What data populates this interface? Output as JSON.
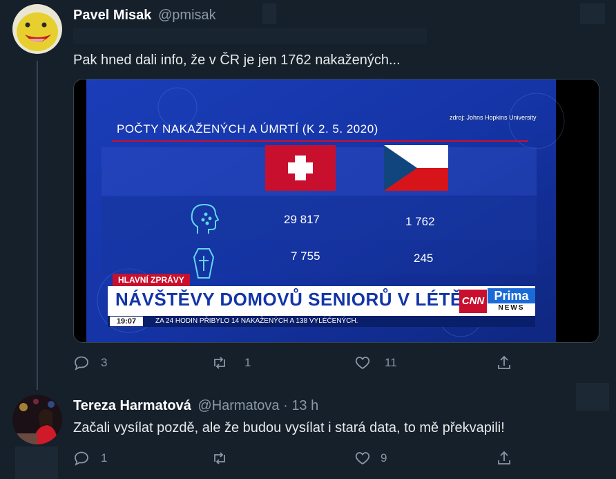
{
  "tweet1": {
    "name": "Pavel Misak",
    "handle": "@pmisak",
    "text": "Pak hned dali info, že v ČR je jen 1762 nakažených...",
    "actions": {
      "reply_count": "3",
      "retweet_count": "1",
      "like_count": "11"
    },
    "media": {
      "source": "zdroj: Johns Hopkins University",
      "title": "POČTY NAKAŽENÝCH A ÚMRTÍ (K 2. 5. 2020)",
      "infected_ch": "29 817",
      "infected_cz": "1 762",
      "deaths_ch": "7 755",
      "deaths_cz": "245",
      "show_label": "HLAVNÍ ZPRÁVY",
      "headline": "NÁVŠTĚVY DOMOVŮ SENIORŮ V LÉTĚ",
      "clock": "19:07",
      "ticker": "ZA 24 HODIN PŘIBYLO 14 NAKAŽENÝCH A 138 VYLÉČENÝCH.",
      "logo_cnn": "CNN",
      "logo_prima": "Prima",
      "logo_news": "NEWS"
    }
  },
  "tweet2": {
    "name": "Tereza Harmatová",
    "handle": "@Harmatova",
    "dot": "·",
    "time": "13 h",
    "text": "Začali vysílat pozdě, ale že budou vysílat i stará data, to mě překvapili!",
    "actions": {
      "reply_count": "1",
      "like_count": "9"
    }
  },
  "colors": {
    "background": "#15202b",
    "muted": "#8b98a5",
    "tv_blue": "#1b3fbf",
    "tv_red": "#c8102e",
    "cyan": "#5fd8f0"
  }
}
